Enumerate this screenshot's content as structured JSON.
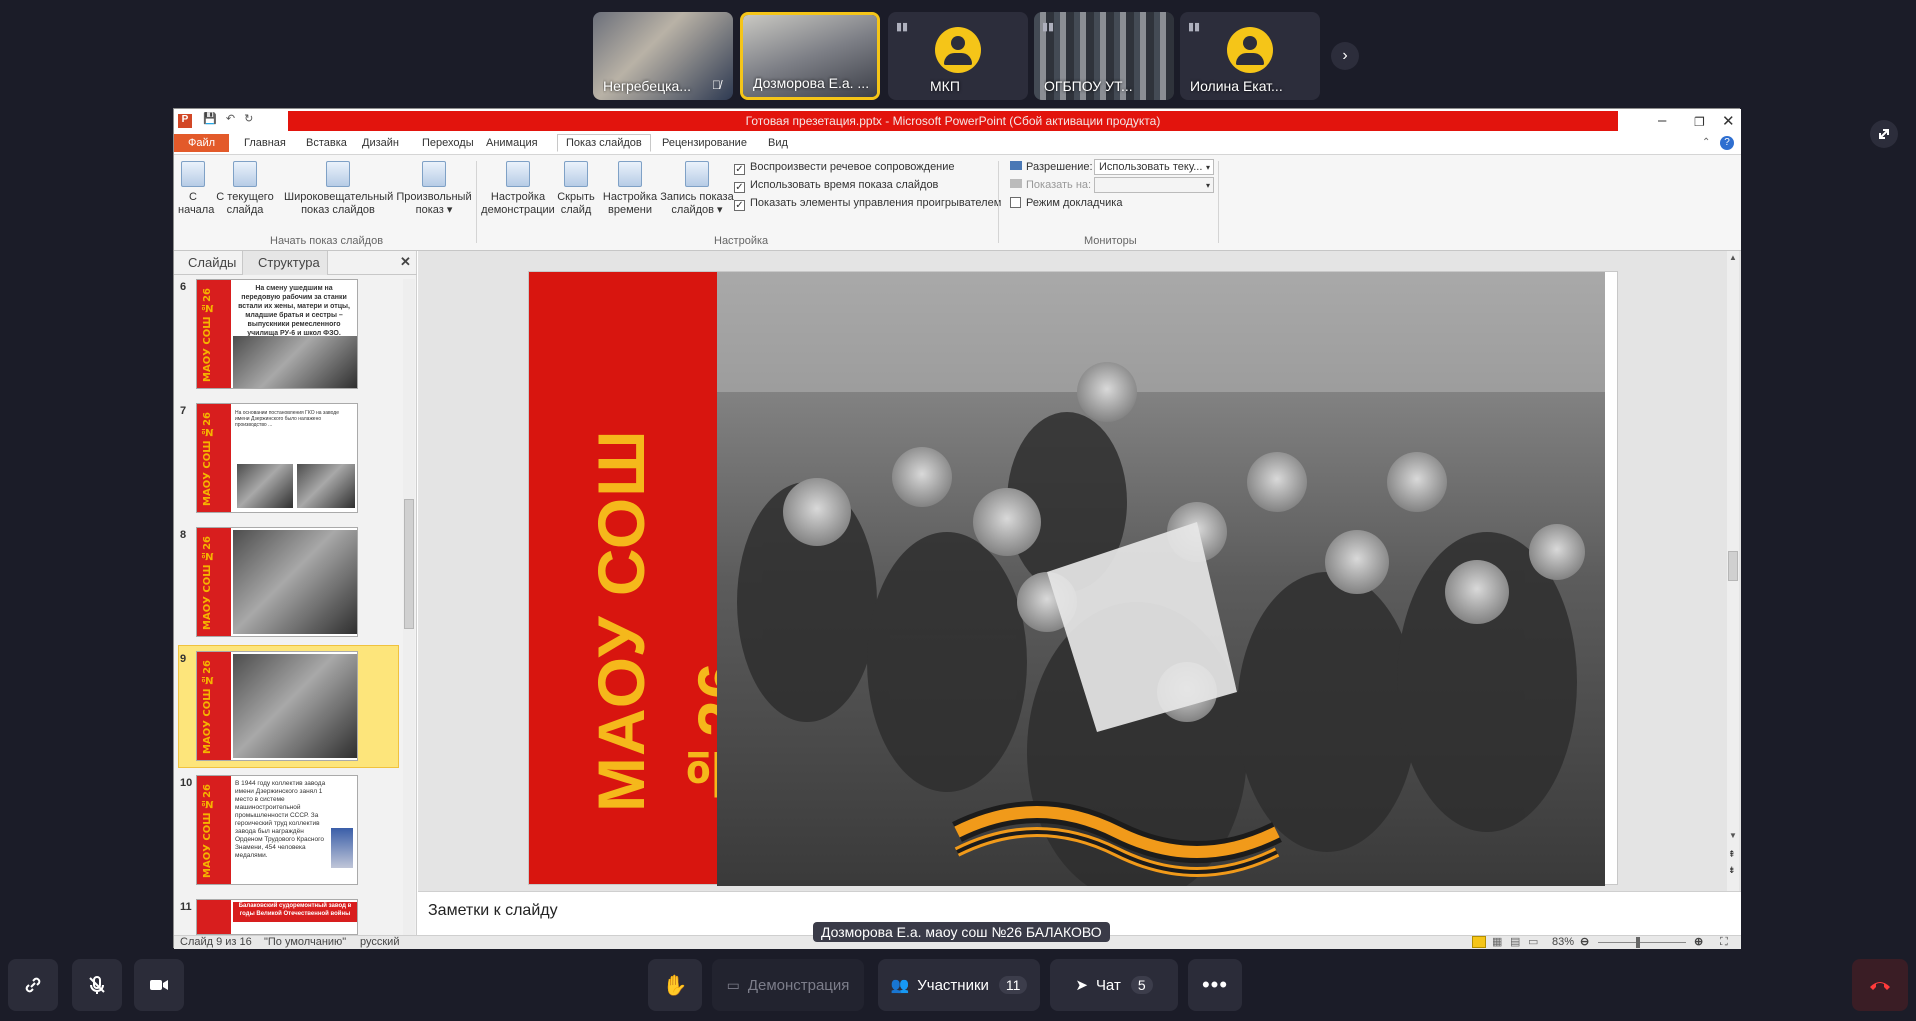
{
  "participants": [
    {
      "name": "Негребецка...",
      "muted": true
    },
    {
      "name": "Дозморова Е.а. ...",
      "muted": false,
      "active": true
    },
    {
      "name": "МКП",
      "muted": true
    },
    {
      "name": "ОГБПОУ УТ...",
      "muted": true
    },
    {
      "name": "Иолина Екат...",
      "muted": true
    }
  ],
  "ppt": {
    "title": "Готовая презетация.pptx - Microsoft PowerPoint (Сбой активации продукта)",
    "menu": {
      "file": "Файл",
      "tabs": [
        "Главная",
        "Вставка",
        "Дизайн",
        "Переходы",
        "Анимация",
        "Показ слайдов",
        "Рецензирование",
        "Вид"
      ]
    },
    "ribbon": {
      "btn_from_start": "С начала",
      "btn_from_start_l1": "С",
      "btn_from_start_l2": "начала",
      "btn_current_l1": "С текущего",
      "btn_current_l2": "слайда",
      "btn_broadcast_l1": "Широковещательный",
      "btn_broadcast_l2": "показ слайдов",
      "btn_custom_l1": "Произвольный",
      "btn_custom_l2": "показ ▾",
      "group_start": "Начать показ слайдов",
      "btn_setup_l1": "Настройка",
      "btn_setup_l2": "демонстрации",
      "btn_hide_l1": "Скрыть",
      "btn_hide_l2": "слайд",
      "btn_timing_l1": "Настройка",
      "btn_timing_l2": "времени",
      "btn_record_l1": "Запись показа",
      "btn_record_l2": "слайдов ▾",
      "chk_narration": "Воспроизвести речевое сопровождение",
      "chk_timings": "Использовать время показа слайдов",
      "chk_controls": "Показать элементы управления проигрывателем",
      "group_setup": "Настройка",
      "resolution_label": "Разрешение:",
      "resolution_value": "Использовать теку...",
      "show_on_label": "Показать на:",
      "presenter_mode": "Режим докладчика",
      "group_monitors": "Мониторы"
    },
    "pane": {
      "tab_slides": "Слайды",
      "tab_outline": "Структура",
      "close": "✕"
    },
    "thumbs": [
      {
        "num": "6",
        "text": "На смену ушедшим на передовую рабочим за станки встали их жены, матери и отцы, младшие братья и сестры – выпускники ремесленного училища РУ-6 и школ ФЗО."
      },
      {
        "num": "7",
        "text": "На основании постановления ГКО на заводе имени Дзержинского было налажено производство ..."
      },
      {
        "num": "8",
        "text": ""
      },
      {
        "num": "9",
        "text": "",
        "selected": true
      },
      {
        "num": "10",
        "text": "В 1944 году коллектив завода имени Дзержинского занял 1 место в системе машиностроительной промышленности СССР. За героический труд коллектив завода был награждён Орденом Трудового Красного Знамени, 454 человека медалями."
      },
      {
        "num": "11",
        "text": "Балаковский судоремонтный завод в годы Великой Отечественной войны"
      }
    ],
    "slide_vertical_text": "МАОУ СОШ №26",
    "thumb_vertical_text": "МАОУ СОШ №26",
    "notes_placeholder": "Заметки к слайду",
    "status": {
      "slide": "Слайд 9 из 16",
      "theme": "\"По умолчанию\"",
      "lang": "русский",
      "zoom": "83%"
    }
  },
  "speaker_label": "Дозморова Е.а. маоу сош №26 БАЛАКОВО",
  "toolbar": {
    "demo": "Демонстрация",
    "participants": "Участники",
    "participants_count": "11",
    "chat": "Чат",
    "chat_count": "5"
  },
  "colors": {
    "bg": "#1b1c28",
    "accent": "#f5c518",
    "slide_red": "#d8150f",
    "slide_yellow": "#f5b81b"
  }
}
